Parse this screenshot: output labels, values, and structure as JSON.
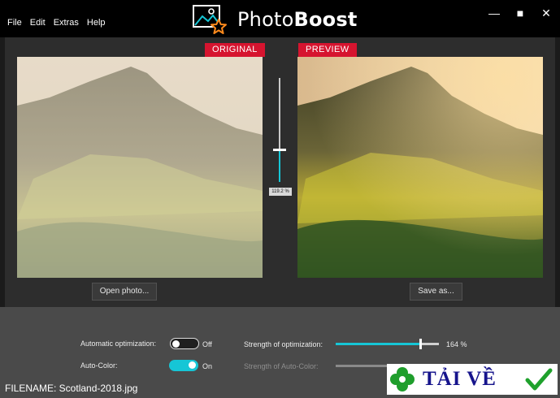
{
  "menu": [
    "File",
    "Edit",
    "Extras",
    "Help"
  ],
  "app": {
    "name_regular": "Photo",
    "name_bold": "Boost"
  },
  "window_controls": {
    "minimize": "—",
    "maximize": "■",
    "close": "✕"
  },
  "original": {
    "tag": "ORIGINAL",
    "open_button": "Open photo..."
  },
  "preview": {
    "tag": "PREVIEW",
    "save_button": "Save as..."
  },
  "compare_slider": {
    "value_label": "119.2 %",
    "level_fraction": 0.31
  },
  "controls": {
    "auto_optimization": {
      "label": "Automatic optimization:",
      "state": "Off",
      "enabled": false
    },
    "auto_color": {
      "label": "Auto-Color:",
      "state": "On",
      "enabled": true
    },
    "strength_optimization": {
      "label": "Strength of optimization:",
      "value": "164 %",
      "level_fraction": 0.82
    },
    "strength_auto_color": {
      "label": "Strength of Auto-Color:"
    }
  },
  "status": {
    "filename": "FILENAME: Scotland-2018.jpg"
  },
  "watermark": {
    "text": "TẢI VỀ"
  },
  "colors": {
    "accent": "#16c6d6",
    "tag_red": "#d6142f",
    "panel": "#4a4a4a",
    "titlebar": "#000000"
  },
  "icons": [
    "photoboost-logo",
    "clover-icon",
    "checkmark-icon"
  ]
}
